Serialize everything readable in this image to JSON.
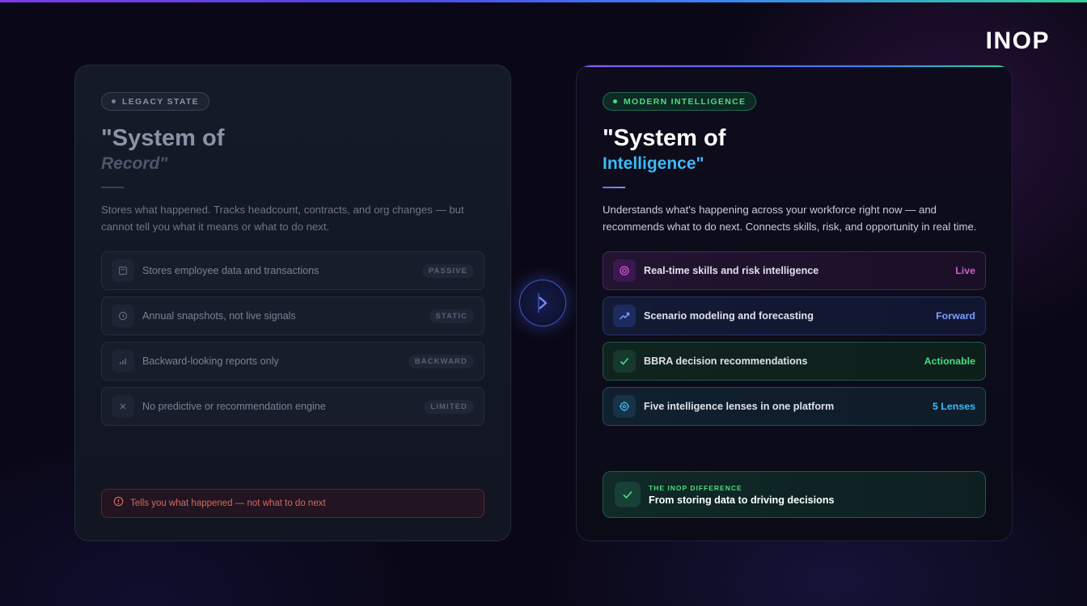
{
  "brand": "INOP",
  "legacy": {
    "badge": "LEGACY STATE",
    "title_line1": "\"System of",
    "title_line2": "Record\"",
    "description": "Stores what happened. Tracks headcount, contracts, and org changes — but cannot tell you what it means or what to do next.",
    "features": [
      {
        "icon": "file-icon",
        "label": "Stores employee data and transactions",
        "tag": "PASSIVE"
      },
      {
        "icon": "clock-icon",
        "label": "Annual snapshots, not live signals",
        "tag": "STATIC"
      },
      {
        "icon": "bar-chart-icon",
        "label": "Backward-looking reports only",
        "tag": "BACKWARD"
      },
      {
        "icon": "x-icon",
        "label": "No predictive or recommendation engine",
        "tag": "LIMITED"
      }
    ],
    "warning": "Tells you what happened — not what to do next"
  },
  "modern": {
    "badge": "MODERN INTELLIGENCE",
    "title_line1": "\"System of",
    "title_line2": "Intelligence\"",
    "description": "Understands what's happening across your workforce right now — and recommends what to do next. Connects skills, risk, and opportunity in real time.",
    "features": [
      {
        "icon": "target-icon",
        "label": "Real-time skills and risk intelligence",
        "tag": "Live",
        "color": "#d25bd6"
      },
      {
        "icon": "trend-up-icon",
        "label": "Scenario modeling and forecasting",
        "tag": "Forward",
        "color": "#7c9cff"
      },
      {
        "icon": "check-icon",
        "label": "BBRA decision recommendations",
        "tag": "Actionable",
        "color": "#4ade80"
      },
      {
        "icon": "crosshair-icon",
        "label": "Five intelligence lenses in one platform",
        "tag": "5 Lenses",
        "color": "#38bdf8"
      }
    ],
    "difference": {
      "label": "THE INOP DIFFERENCE",
      "text": "From storing data to driving decisions"
    }
  },
  "colors": {
    "accent_green": "#4ade80",
    "accent_purple": "#d25bd6",
    "accent_blue": "#7c9cff",
    "accent_cyan": "#38bdf8",
    "warning_red": "#d36b5f"
  }
}
